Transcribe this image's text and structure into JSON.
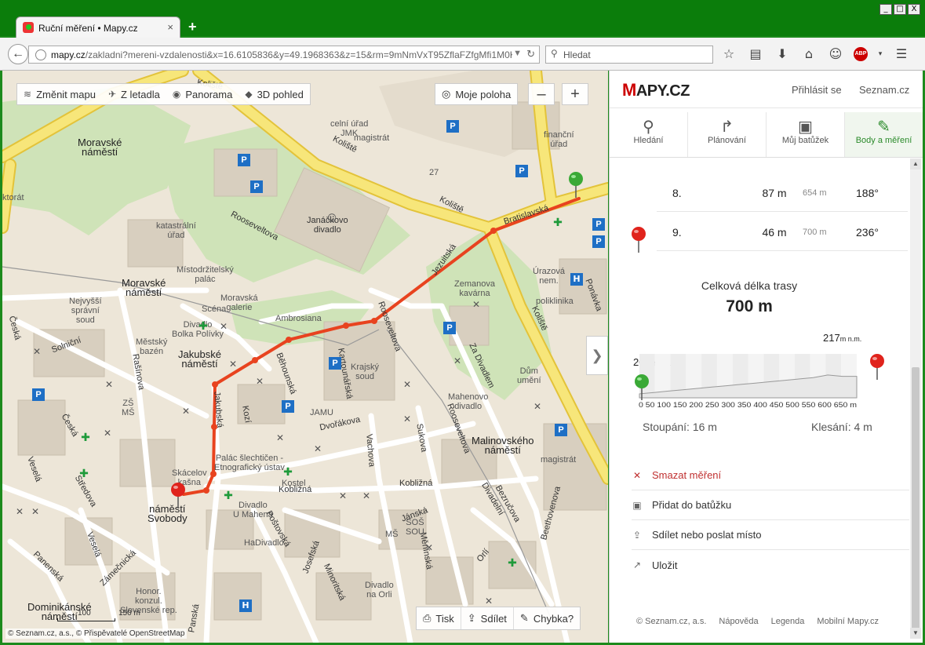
{
  "window": {
    "tab_title": "Ruční měření • Mapy.cz",
    "new_tab": "+",
    "minimize": "_",
    "maximize": "□",
    "close": "X"
  },
  "browser": {
    "url_host": "mapy.cz",
    "url_rest": "/zakladni?mereni-vzdalenosti&x=16.6105836&y=49.1968363&z=15&rm=9mNmVxT95ZflaFZfgMfi1M0K1AK45EIIM",
    "search_placeholder": "Hledat"
  },
  "map": {
    "toolbar": {
      "change_map": "Změnit mapu",
      "from_plane": "Z letadla",
      "panorama": "Panorama",
      "view_3d": "3D pohled"
    },
    "my_location": "Moje poloha",
    "zoom_out": "–",
    "zoom_in": "+",
    "expand": "❯",
    "bottom": {
      "print": "Tisk",
      "share": "Sdílet",
      "error": "Chybka?"
    },
    "copyright": "© Seznam.cz, a.s., © Přispěvatelé OpenStreetMap",
    "scale": {
      "mid": "100",
      "end": "150 m"
    },
    "labels": [
      {
        "k": "moravske",
        "text": "Moravské\nnáměstí"
      },
      {
        "k": "moravske2",
        "text": "Moravské\nnáměstí"
      },
      {
        "k": "jakubske",
        "text": "Jakubské\nnáměstí"
      },
      {
        "k": "svobody",
        "text": "náměstí\nSvobody"
      },
      {
        "k": "malinovskeho",
        "text": "Malinovského\nnáměstí"
      },
      {
        "k": "dominikanske",
        "text": "Dominikánské\nnáměstí"
      },
      {
        "k": "katastralni",
        "text": "katastrální\núřad"
      },
      {
        "k": "mistodrzitelsky",
        "text": "Místodržitelský\npalác"
      },
      {
        "k": "nejvyssi",
        "text": "Nejvyšší\nsprávní\nsoud"
      },
      {
        "k": "celni",
        "text": "celní úřad\nJMK"
      },
      {
        "k": "magistrat1",
        "text": "magistrát"
      },
      {
        "k": "financni",
        "text": "finanční\núřad"
      },
      {
        "k": "janackovo",
        "text": "Janáčkovo\ndivadlo"
      },
      {
        "k": "zemanova",
        "text": "Zemanova\nkavárna"
      },
      {
        "k": "urazova",
        "text": "Úrazová\nnem."
      },
      {
        "k": "poliklinika",
        "text": "poliklinika"
      },
      {
        "k": "ambrosiana",
        "text": "Ambrosiana"
      },
      {
        "k": "krajsky",
        "text": "Krajský\nsoud"
      },
      {
        "k": "dum",
        "text": "Dům\numění"
      },
      {
        "k": "mahenovo",
        "text": "Mahenovo\ndivadlo"
      },
      {
        "k": "jamu",
        "text": "JAMU"
      },
      {
        "k": "palac",
        "text": "Palác šlechtičen -\nEtnografický ústav"
      },
      {
        "k": "skacelov",
        "text": "Skácelov\nkašna"
      },
      {
        "k": "hadivadlo",
        "text": "HaDivadlo"
      },
      {
        "k": "magistrat2",
        "text": "magistrát"
      },
      {
        "k": "sos",
        "text": "SOŠ\nSOU"
      },
      {
        "k": "ms",
        "text": "MŠ"
      },
      {
        "k": "zsms",
        "text": "ZŠ\nMŠ"
      },
      {
        "k": "divadlo",
        "text": "Divadlo\nna Orli"
      },
      {
        "k": "honor",
        "text": "Honor.\nkonzul.\nSlovenské rep."
      },
      {
        "k": "moravska",
        "text": "Moravská\ngalerie"
      },
      {
        "k": "vecky",
        "text": "Městský\nbazén"
      },
      {
        "k": "mahena",
        "text": "Divadlo\nU Mahena"
      },
      {
        "k": "dvur",
        "text": "Divadlo\nBolka Polívky"
      },
      {
        "k": "scena",
        "text": "Scéna"
      },
      {
        "k": "kostel",
        "text": "Kostel"
      },
      {
        "k": "n27",
        "text": "27"
      },
      {
        "k": "ktorat",
        "text": "ktorát"
      }
    ],
    "streets": {
      "kolište1": "Koliště",
      "kolište2": "Koliště",
      "kolište3": "Koliště",
      "kolište4": "Koliště",
      "bratislavska": "Bratislavská",
      "rooseveltova1": "Rooseveltova",
      "rooseveltova2": "Rooseveltova",
      "rooseveltova3": "Rooseveltova",
      "jezuitska": "Jezuitská",
      "zadivadlem": "Za Divadlem",
      "dvorakova": "Dvořákova",
      "kobližna1": "Kobližná",
      "kobližna2": "Kobližná",
      "sukova": "Sukova",
      "vachova": "Vachova",
      "janska": "Jánská",
      "postovska": "Poštovská",
      "solnicni": "Solniční",
      "ceska1": "Česká",
      "ceska2": "Česká",
      "rasinova": "Rašínova",
      "stredova": "Středova",
      "vesela1": "Veselá",
      "vesela2": "Veselá",
      "zamecnicka": "Zámečnická",
      "panenska": "Panenská",
      "orli": "Orlí",
      "beethovenova": "Beethovenova",
      "bezruc": "Bezručova",
      "mecova": "Měnínská",
      "minoritska": "Minoritská",
      "josefska": "Josefská",
      "kozi": "Kozí",
      "divadelni": "Divadelní",
      "pracharska": "Pražská",
      "poheracka": "Ponávka",
      "jakubska": "Jakubská",
      "betheho": "Běhounská",
      "kartova": "Kartounářská",
      "vaclavska": "Údolní",
      "benesova": "Kozí",
      "sillingrovo": "Šilingrovo",
      "dominika": "Dominikánská",
      "kapucin": "Kapucínská",
      "kvetna": "Květná",
      "slovanska": "Slovanská",
      "ceskadx": "Česká",
      "bratrska": "Běhounská",
      "mecova2": "Mečová",
      "pansk": "Panská"
    }
  },
  "side": {
    "logo_m": "M",
    "logo_rest": "APY.CZ",
    "login": "Přihlásit se",
    "seznam": "Seznam.cz",
    "tabs": [
      {
        "label": "Hledání",
        "icon": "search-icon"
      },
      {
        "label": "Plánování",
        "icon": "route-icon"
      },
      {
        "label": "Můj batůžek",
        "icon": "backpack-icon"
      },
      {
        "label": "Body a měření",
        "icon": "measure-icon"
      }
    ],
    "rows": [
      {
        "n": "8.",
        "d": "87 m",
        "c": "654 m",
        "a": "188°"
      },
      {
        "n": "9.",
        "d": "46 m",
        "c": "700 m",
        "a": "236°"
      }
    ],
    "total_label": "Celková délka trasy",
    "total": "700 m",
    "profile": {
      "max_label": "217",
      "max_unit": "m n.m.",
      "min_label": "203",
      "min_unit": "m n.m.",
      "axis": "0 50 100 150 200 250 300 350 400 450 500 550 600 650 m",
      "elevations": [
        203,
        204,
        205,
        206,
        207,
        208,
        209,
        210,
        211,
        212,
        213,
        214,
        215,
        217,
        216,
        216
      ],
      "distance_max": 700
    },
    "ascent": "Stoupání: 16 m",
    "descent": "Klesání: 4 m",
    "actions": [
      {
        "label": "Smazat měření",
        "icon": "delete-icon"
      },
      {
        "label": "Přidat do batůžku",
        "icon": "backpack-icon"
      },
      {
        "label": "Sdílet nebo poslat místo",
        "icon": "share-icon"
      },
      {
        "label": "Uložit",
        "icon": "save-icon"
      }
    ],
    "footer": {
      "copy": "© Seznam.cz, a.s.",
      "help": "Nápověda",
      "legend": "Legenda",
      "mobile": "Mobilní Mapy.cz"
    }
  }
}
